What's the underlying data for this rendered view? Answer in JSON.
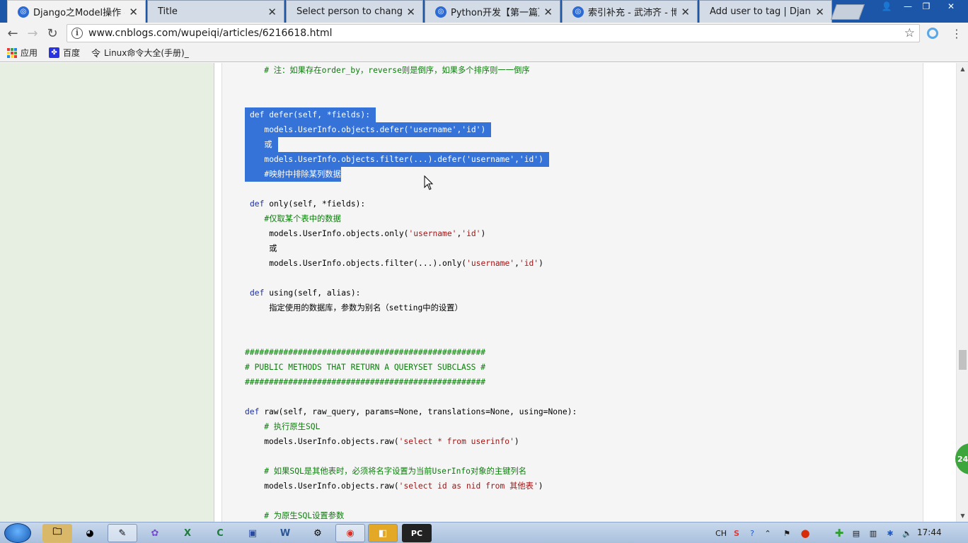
{
  "tabs": [
    {
      "label": "Django之Model操作 - 武",
      "icon": "cnblogs-icon",
      "active": true
    },
    {
      "label": "Title",
      "icon": "page-icon",
      "active": false
    },
    {
      "label": "Select person to chang",
      "icon": "page-icon",
      "active": false
    },
    {
      "label": "Python开发【第一篇】",
      "icon": "cnblogs-icon",
      "active": false
    },
    {
      "label": "索引补充 - 武沛齐 - 博客",
      "icon": "cnblogs-icon",
      "active": false
    },
    {
      "label": "Add user to tag | Djang",
      "icon": "page-icon",
      "active": false
    }
  ],
  "toolbar": {
    "url": "www.cnblogs.com/wupeiqi/articles/6216618.html"
  },
  "bookmarks": [
    {
      "label": "应用",
      "icon": "apps-grid-icon"
    },
    {
      "label": "百度",
      "icon": "paw-icon"
    },
    {
      "label": "Linux命令大全(手册)_",
      "icon": "command-icon"
    }
  ],
  "code": {
    "l1": "    # 注：如果存在order_by，reverse则是倒序，如果多个排序则一一倒序",
    "defer_kw": "def",
    "defer_sig": " defer(self, *fields):",
    "defer_l1_pre": "   models.UserInfo.objects.defer(",
    "defer_l1_s1": "'username'",
    "defer_l1_s2": "'id'",
    "or": "或",
    "defer_l3_pre": "   models.UserInfo.objects.filter(...).defer(",
    "defer_l3_s1": "'username'",
    "defer_l3_s2": "'id'",
    "defer_comment": "   #映射中排除某列数据",
    "only_kw": "def",
    "only_sig": " only(self, *fields):",
    "only_comment": "   #仅取某个表中的数据",
    "only_l1_pre": "    models.UserInfo.objects.only(",
    "only_l1_s1": "'username'",
    "only_l1_s2": "'id'",
    "only_or": "    或",
    "only_l3_pre": "    models.UserInfo.objects.filter(...).only(",
    "only_l3_s1": "'username'",
    "only_l3_s2": "'id'",
    "using_kw": "def",
    "using_sig": " using(self, alias):",
    "using_body": "    指定使用的数据库，参数为别名（setting中的设置）",
    "hash1": "##################################################",
    "public_title": "# PUBLIC METHODS THAT RETURN A QUERYSET SUBCLASS #",
    "hash2": "##################################################",
    "raw_kw": "def",
    "raw_sig": " raw(self, raw_query, params=None, translations=None, using=None):",
    "raw_c1": "    # 执行原生SQL",
    "raw_l1_pre": "    models.UserInfo.objects.raw(",
    "raw_l1_s": "'select * from userinfo'",
    "raw_c2": "    # 如果SQL是其他表时，必须将名字设置为当前UserInfo对象的主键列名",
    "raw_l2_pre": "    models.UserInfo.objects.raw(",
    "raw_l2_s": "'select id as nid from 其他表'",
    "raw_c3": "    # 为原生SQL设置参数"
  },
  "taskbar": {
    "clock": "17:44",
    "ime": "CH",
    "badge": "24"
  },
  "colors": {
    "tabstrip": "#1b56a8",
    "selection": "#3673d9",
    "sidebar": "#e7efe2",
    "keyword": "#1c2fa8",
    "comment": "#0a7d0a",
    "string": "#a31515"
  }
}
